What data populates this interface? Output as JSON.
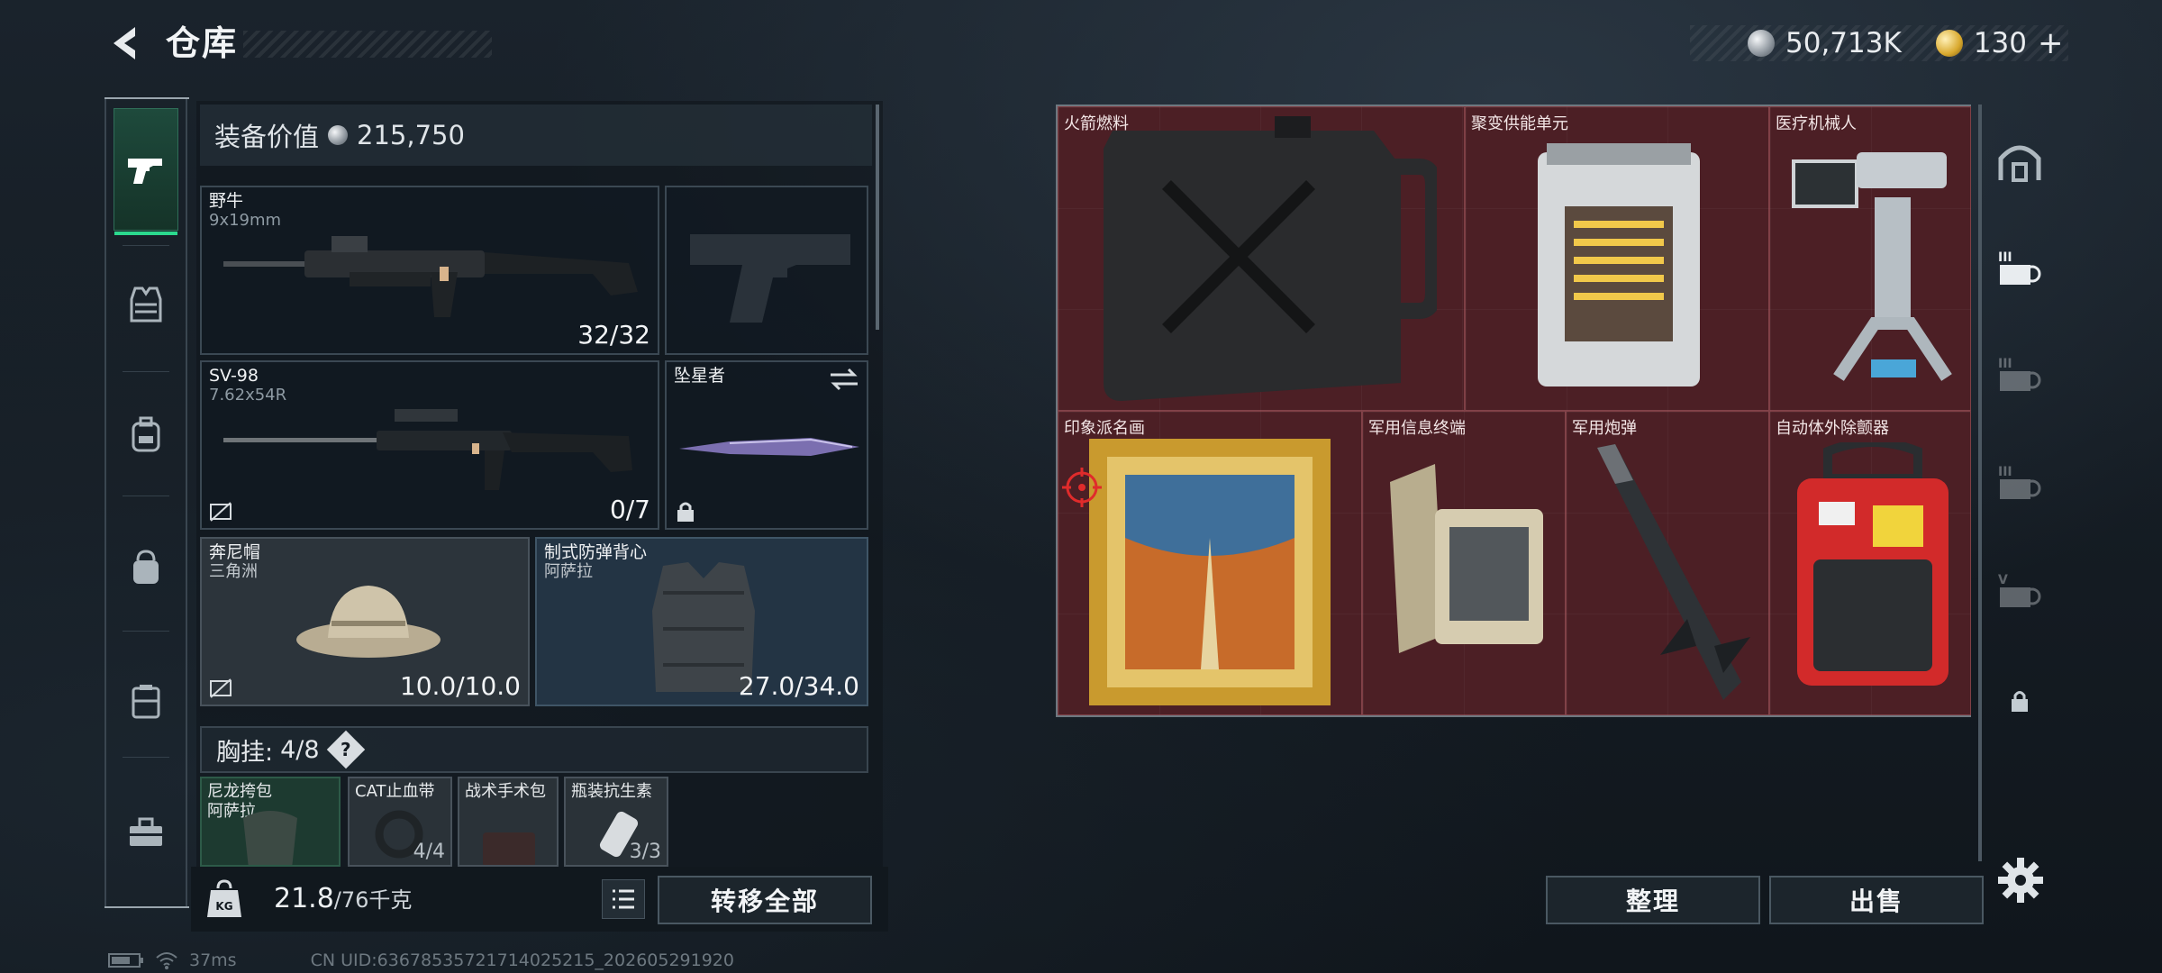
{
  "header": {
    "title": "仓库",
    "currency_primary": "50,713K",
    "currency_secondary": "130",
    "add_symbol": "+"
  },
  "equipment": {
    "value_label": "装备价值",
    "value": "215,750",
    "primary_weapon": {
      "name": "野牛",
      "ammo": "9x19mm",
      "count": "32/32"
    },
    "secondary_weapon": {
      "name": "SV-98",
      "ammo": "7.62x54R",
      "count": "0/7"
    },
    "melee": {
      "name": "坠星者"
    },
    "helmet": {
      "name": "奔尼帽",
      "origin": "三角洲",
      "durability": "10.0/10.0"
    },
    "armor": {
      "name": "制式防弹背心",
      "origin": "阿萨拉",
      "durability": "27.0/34.0"
    },
    "chest_rig": {
      "label": "胸挂:",
      "capacity": "4/8",
      "help": "?"
    },
    "rig_items": [
      {
        "name": "尼龙挎包",
        "sub": "阿萨拉",
        "count": ""
      },
      {
        "name": "CAT止血带",
        "sub": "",
        "count": "4/4"
      },
      {
        "name": "战术手术包",
        "sub": "",
        "count": ""
      },
      {
        "name": "瓶装抗生素",
        "sub": "",
        "count": "3/3"
      }
    ]
  },
  "weight": {
    "current": "21.8",
    "max": "/76千克",
    "icon_text": "KG"
  },
  "buttons": {
    "transfer_all": "转移全部",
    "sort": "整理",
    "sell": "出售"
  },
  "stash": {
    "items": [
      {
        "name": "火箭燃料"
      },
      {
        "name": "聚变供能单元"
      },
      {
        "name": "医疗机械人"
      },
      {
        "name": "印象派名画"
      },
      {
        "name": "军用信息终端"
      },
      {
        "name": "军用炮弹"
      },
      {
        "name": "自动体外除颤器"
      }
    ]
  },
  "status_bar": {
    "ping": "37ms",
    "uid": "CN UID:6367853572171402521​5_202605291920"
  },
  "colors": {
    "accent_green": "#2bd98e",
    "stash_red": "#4c1f25"
  }
}
